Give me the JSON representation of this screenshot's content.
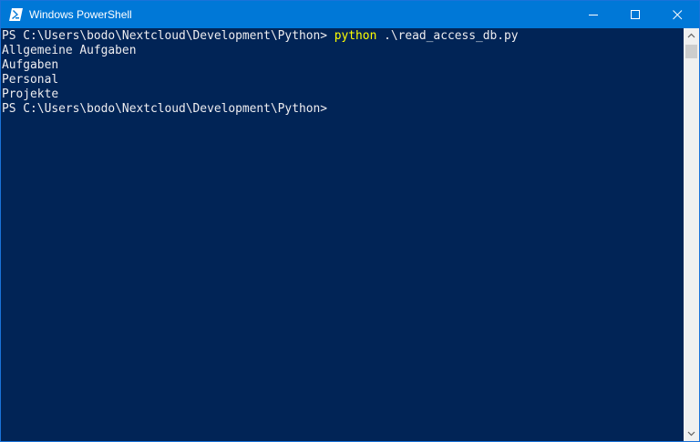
{
  "window": {
    "title": "Windows PowerShell",
    "icon": "powershell-icon",
    "controls": [
      "minimize-icon",
      "maximize-icon",
      "close-icon"
    ]
  },
  "console": {
    "prompt": "PS C:\\Users\\bodo\\Nextcloud\\Development\\Python>",
    "command": "python",
    "argument": " .\\read_access_db.py",
    "output": [
      "Allgemeine Aufgaben",
      "Aufgaben",
      "Personal",
      "Projekte"
    ],
    "final_prompt": "PS C:\\Users\\bodo\\Nextcloud\\Development\\Python>"
  },
  "colors": {
    "console_background": "#012456",
    "titlebar": "#0078d7",
    "console_text": "#eeedf0",
    "command_text": "#ffff00"
  }
}
